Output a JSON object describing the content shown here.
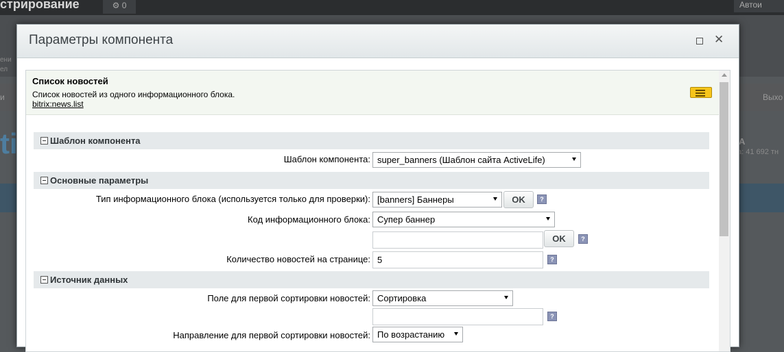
{
  "background": {
    "page_title": "стрирование",
    "gear_count": "0",
    "user_label": "Автои",
    "exit_label": "Выхо",
    "left_label": "и",
    "big_text": "ti",
    "side_letter": "A",
    "side_count": "а: 41 692 тн",
    "small_text_1": "ени",
    "small_text_2": "ел"
  },
  "dialog": {
    "title": "Параметры компонента",
    "maximize_icon": "maximize-icon",
    "close_icon": "close-icon",
    "close_glyph": "✕"
  },
  "component": {
    "name": "Список новостей",
    "description": "Список новостей из одного информационного блока.",
    "code": "bitrix:news.list",
    "icon": "component-icon"
  },
  "sections": {
    "template": "Шаблон компонента",
    "main": "Основные параметры",
    "source": "Источник данных"
  },
  "fields": {
    "template_label": "Шаблон компонента:",
    "template_value": "super_banners (Шаблон сайта ActiveLife)",
    "iblock_type_label": "Тип информационного блока (используется только для проверки):",
    "iblock_type_value": "[banners] Баннеры",
    "iblock_code_label": "Код информационного блока:",
    "iblock_code_value": "Супер баннер",
    "iblock_code_extra": "",
    "news_count_label": "Количество новостей на странице:",
    "news_count_value": "5",
    "sort_field_label": "Поле для первой сортировки новостей:",
    "sort_field_value": "Сортировка",
    "sort_field_extra": "",
    "sort_dir_label": "Направление для первой сортировки новостей:",
    "sort_dir_value": "По возрастанию"
  },
  "buttons": {
    "ok": "OK",
    "help": "?"
  }
}
